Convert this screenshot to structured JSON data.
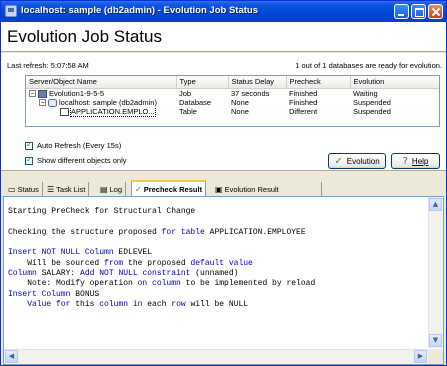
{
  "window": {
    "title": "localhost: sample (db2admin) - Evolution Job Status"
  },
  "header": {
    "title": "Evolution Job Status"
  },
  "status": {
    "last_refresh": "Last refresh: 5:07:58 AM",
    "databases_ready": "1 out of 1 databases are ready for evolution."
  },
  "grid": {
    "columns": [
      "Server/Object Name",
      "Type",
      "Status Delay",
      "Precheck",
      "Evolution"
    ],
    "rows": [
      {
        "name": "Evolution1-9-5-5",
        "type": "Job",
        "delay": "37 seconds",
        "precheck": "Finished",
        "evolution": "Waiting",
        "icon": "job-icon",
        "expander": "−"
      },
      {
        "name": "localhost: sample (db2admin)",
        "type": "Database",
        "delay": "None",
        "precheck": "Finished",
        "evolution": "Suspended",
        "icon": "database-icon",
        "expander": "−"
      },
      {
        "name": "APPLICATION.EMPLO...",
        "type": "Table",
        "delay": "None",
        "precheck": "Different",
        "evolution": "Suspended",
        "icon": "table-icon",
        "expander": ""
      }
    ]
  },
  "options": {
    "auto_refresh": "Auto Refresh (Every 15s)",
    "auto_refresh_checked": true,
    "show_different": "Show different objects only",
    "show_different_checked": true
  },
  "buttons": {
    "evolution": "Evolution",
    "help": "Help"
  },
  "tabs": [
    {
      "label": "Status",
      "icon": "status-icon"
    },
    {
      "label": "Task List",
      "icon": "task-list-icon"
    },
    {
      "label": "Log",
      "icon": "log-icon"
    },
    {
      "label": "Precheck Result",
      "icon": "precheck-icon",
      "active": true
    },
    {
      "label": "Evolution Result",
      "icon": "evolution-result-icon"
    }
  ],
  "precheck": {
    "lines": [
      [],
      [
        [
          "Starting PreCheck for Structural Change",
          ""
        ]
      ],
      [],
      [
        [
          "Checking the structure proposed ",
          ""
        ],
        [
          "for table",
          "kw"
        ],
        [
          " APPLICATION.EMPLOYEE",
          ""
        ]
      ],
      [],
      [
        [
          "Insert NOT NULL Column",
          "kw"
        ],
        [
          " EDLEVEL",
          ""
        ]
      ],
      [
        [
          "    Will be sourced ",
          ""
        ],
        [
          "from",
          "kw"
        ],
        [
          " the proposed ",
          ""
        ],
        [
          "default value",
          "kw"
        ]
      ],
      [
        [
          "Column",
          "kw"
        ],
        [
          " SALARY: ",
          ""
        ],
        [
          "Add NOT NULL constraint",
          "kw"
        ],
        [
          " (unnamed)",
          ""
        ]
      ],
      [
        [
          "    Note: Modify operation ",
          ""
        ],
        [
          "on column",
          "kw"
        ],
        [
          " to be implemented by reload",
          ""
        ]
      ],
      [
        [
          "Insert Column",
          "kw"
        ],
        [
          " BONUS",
          ""
        ]
      ],
      [
        [
          "    ",
          ""
        ],
        [
          "Value for",
          "kw"
        ],
        [
          " this ",
          ""
        ],
        [
          "column in",
          "kw"
        ],
        [
          " each ",
          ""
        ],
        [
          "row",
          "kw"
        ],
        [
          " will be NULL",
          ""
        ]
      ]
    ]
  },
  "colors": {
    "titlebar": "#0A54E0",
    "keyword": "#0000C0",
    "active_tab_accent": "#FFC83C"
  }
}
